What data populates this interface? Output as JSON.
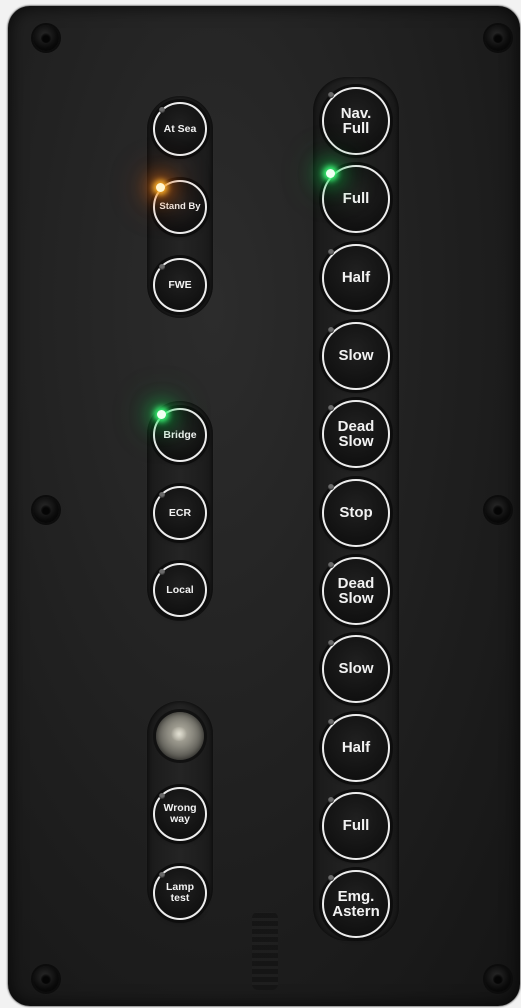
{
  "left_panel": {
    "mode_group": {
      "at_sea": "At Sea",
      "stand_by": "Stand By",
      "fwe": "FWE"
    },
    "location_group": {
      "bridge": "Bridge",
      "ecr": "ECR",
      "local": "Local"
    },
    "alarm_group": {
      "wrong_way": "Wrong\nway",
      "lamp_test": "Lamp\ntest"
    }
  },
  "telegraph": {
    "ahead": {
      "nav_full": "Nav.\nFull",
      "full": "Full",
      "half": "Half",
      "slow": "Slow",
      "dead_slow": "Dead\nSlow"
    },
    "stop": "Stop",
    "astern": {
      "dead_slow": "Dead\nSlow",
      "slow": "Slow",
      "half": "Half",
      "full": "Full",
      "emg_astern": "Emg.\nAstern"
    }
  },
  "indicators": {
    "stand_by_led": "on-orange",
    "bridge_led": "on-green",
    "full_ahead_led": "on-green",
    "led_off_color": "#6b6b6b",
    "led_orange_color": "#ffb229",
    "led_green_color": "#3dff7a"
  }
}
